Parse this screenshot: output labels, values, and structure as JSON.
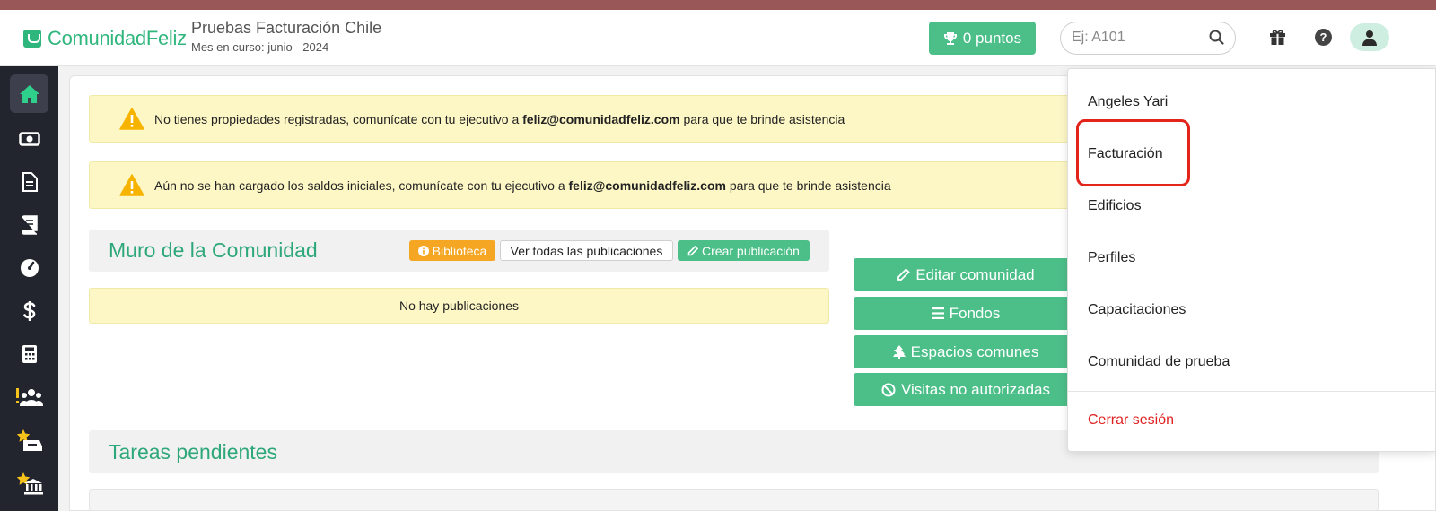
{
  "header": {
    "logo_text": "ComunidadFeliz",
    "community_name": "Pruebas Facturación Chile",
    "period": "Mes en curso: junio - 2024",
    "points_label": "0 puntos",
    "search_placeholder": "Ej: A101"
  },
  "sidebar": {
    "items": [
      {
        "icon": "home-icon",
        "active": true
      },
      {
        "icon": "money-icon"
      },
      {
        "icon": "document-icon"
      },
      {
        "icon": "book-icon"
      },
      {
        "icon": "gauge-icon"
      },
      {
        "icon": "dollar-icon"
      },
      {
        "icon": "calculator-icon"
      },
      {
        "icon": "people-alert-icon"
      },
      {
        "icon": "star-inbox-icon"
      },
      {
        "icon": "star-bank-icon"
      }
    ]
  },
  "alerts": [
    {
      "text_before": "No tienes propiedades registradas, comunícate con tu ejecutivo a ",
      "email": "feliz@comunidadfeliz.com",
      "text_after": " para que te brinde asistencia"
    },
    {
      "text_before": "Aún no se han cargado los saldos iniciales, comunícate con tu ejecutivo a ",
      "email": "feliz@comunidadfeliz.com",
      "text_after": " para que te brinde asistencia"
    }
  ],
  "wall": {
    "title": "Muro de la Comunidad",
    "library_label": "Biblioteca",
    "see_all_label": "Ver todas las publicaciones",
    "create_label": "Crear publicación",
    "empty_text": "No hay publicaciones"
  },
  "actions": {
    "edit_community": "Editar comunidad",
    "funds": "Fondos",
    "common_spaces": "Espacios comunes",
    "unauthorized_visits": "Visitas no autorizadas"
  },
  "tasks": {
    "title": "Tareas pendientes"
  },
  "user_menu": {
    "user_name": "Angeles Yari",
    "items": [
      "Facturación",
      "Edificios",
      "Perfiles",
      "Capacitaciones",
      "Comunidad de prueba"
    ],
    "logout": "Cerrar sesión"
  },
  "colors": {
    "brand_green": "#4cbf89",
    "sidebar_bg": "#22242e",
    "alert_bg": "#fdf7c6",
    "highlight_red": "#e3241b"
  }
}
